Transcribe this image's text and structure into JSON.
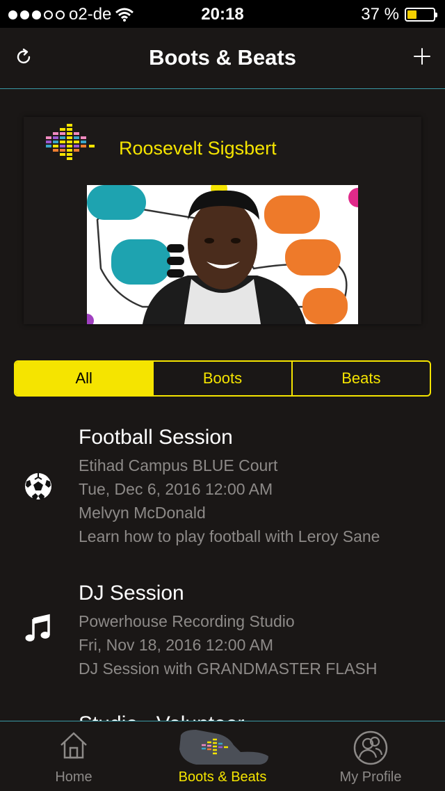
{
  "status_bar": {
    "carrier": "o2-de",
    "time": "20:18",
    "battery": "37 %",
    "battery_level": 0.37,
    "signal_bars": 3
  },
  "nav": {
    "title": "Boots & Beats",
    "left_icon": "refresh-icon",
    "right_icon": "plus-icon"
  },
  "profile_card": {
    "name": "Roosevelt Sigsbert",
    "logo_icon": "equalizer-logo-icon"
  },
  "filter": {
    "options": [
      "All",
      "Boots",
      "Beats"
    ],
    "selected": "All"
  },
  "sessions": [
    {
      "icon": "football-icon",
      "title": "Football Session",
      "lines": [
        "Etihad Campus BLUE Court",
        "Tue, Dec 6, 2016 12:00 AM",
        "Melvyn McDonald",
        "Learn how to play football with Leroy Sane"
      ]
    },
    {
      "icon": "music-note-icon",
      "title": "DJ Session",
      "lines": [
        "Powerhouse Recording Studio",
        "Fri, Nov 18, 2016 12:00 AM",
        "DJ Session with GRANDMASTER FLASH"
      ]
    },
    {
      "icon": "",
      "title": "Studio - Volunteer",
      "lines": []
    }
  ],
  "tabs": [
    {
      "label": "Home",
      "icon": "house-icon"
    },
    {
      "label": "Boots & Beats",
      "icon": "football-boot-icon"
    },
    {
      "label": "My Profile",
      "icon": "profile-icon"
    }
  ],
  "active_tab": "Boots & Beats",
  "colors": {
    "accent": "#f5e400",
    "background": "#1a1716",
    "divider": "#3a9aa6",
    "secondary_text": "#8d8a88"
  }
}
